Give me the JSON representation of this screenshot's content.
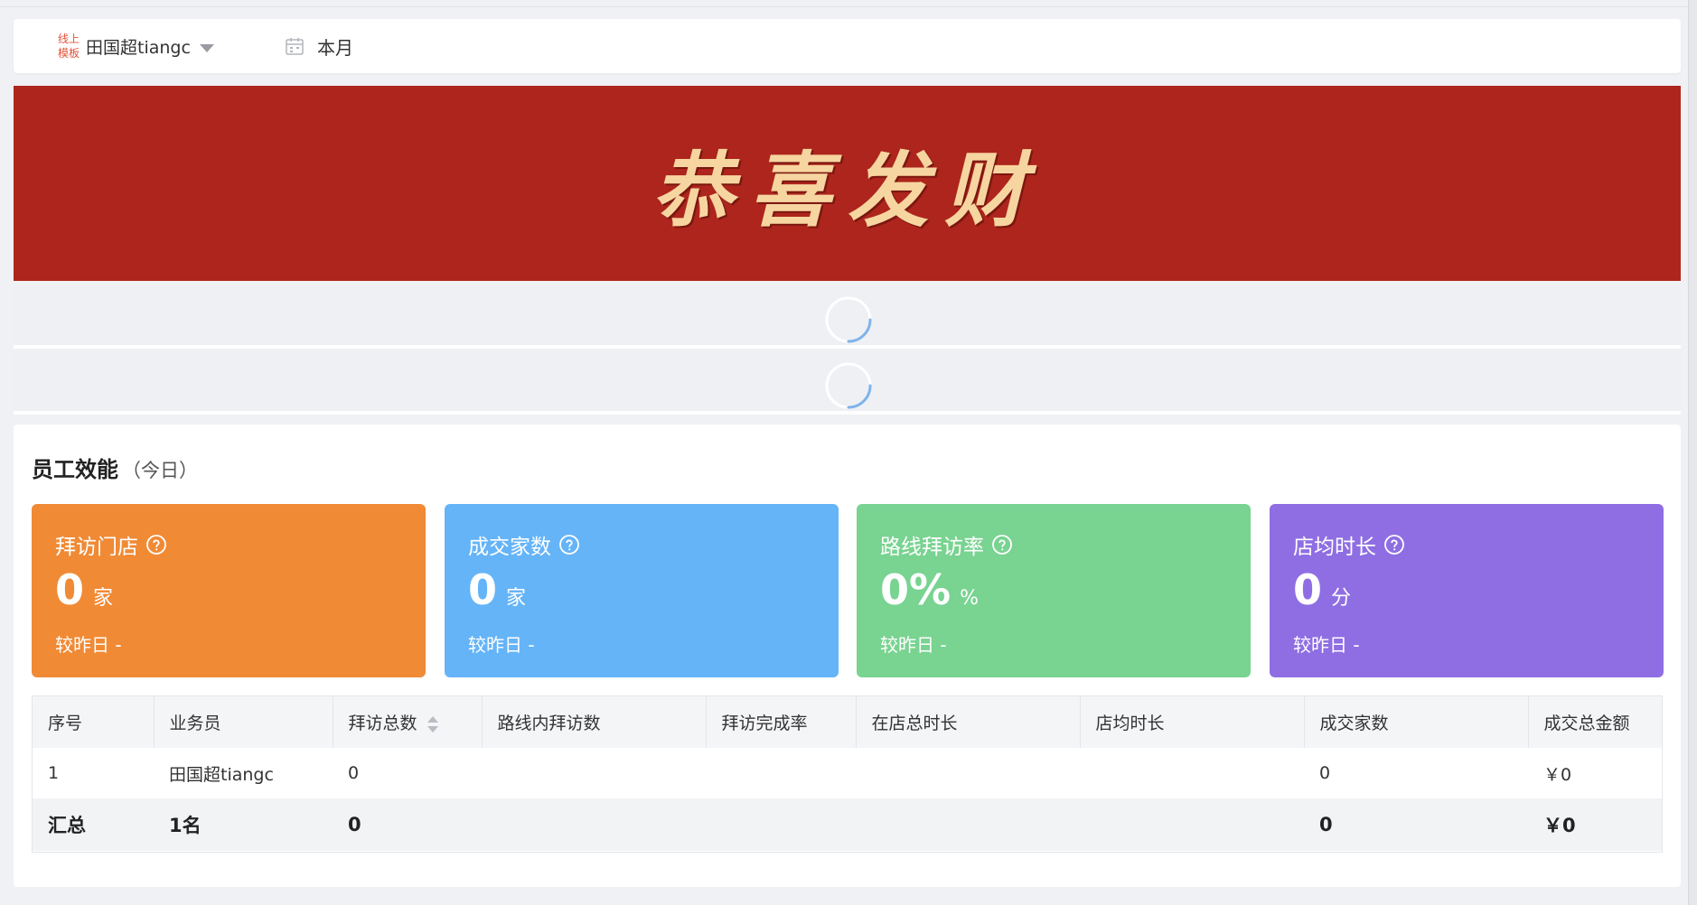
{
  "toolbar": {
    "template_badge_line1": "线上",
    "template_badge_line2": "模板",
    "user_name": "田国超tiangc",
    "date_range": "本月"
  },
  "banner": {
    "text": "恭喜发财"
  },
  "efficiency": {
    "title": "员工效能",
    "subtitle": "（今日）",
    "cards": [
      {
        "title": "拜访门店",
        "value": "0",
        "unit": "家",
        "compare": "较昨日 -",
        "color": "#f08a35"
      },
      {
        "title": "成交家数",
        "value": "0",
        "unit": "家",
        "compare": "较昨日 -",
        "color": "#65b4f8"
      },
      {
        "title": "路线拜访率",
        "value": "0%",
        "unit": "%",
        "compare": "较昨日 -",
        "color": "#79d391"
      },
      {
        "title": "店均时长",
        "value": "0",
        "unit": "分",
        "compare": "较昨日 -",
        "color": "#8f6ee3"
      }
    ]
  },
  "table": {
    "headers": [
      "序号",
      "业务员",
      "拜访总数",
      "路线内拜访数",
      "拜访完成率",
      "在店总时长",
      "店均时长",
      "成交家数",
      "成交总金额"
    ],
    "rows": [
      [
        "1",
        "田国超tiangc",
        "0",
        "",
        "",
        "",
        "",
        "0",
        "￥0"
      ]
    ],
    "summary": [
      "汇总",
      "1名",
      "0",
      "",
      "",
      "",
      "",
      "0",
      "￥0"
    ]
  },
  "colors": {
    "banner_bg": "#ad251c",
    "banner_text": "#f7d5a0",
    "spinner": "#7fb3ea"
  }
}
